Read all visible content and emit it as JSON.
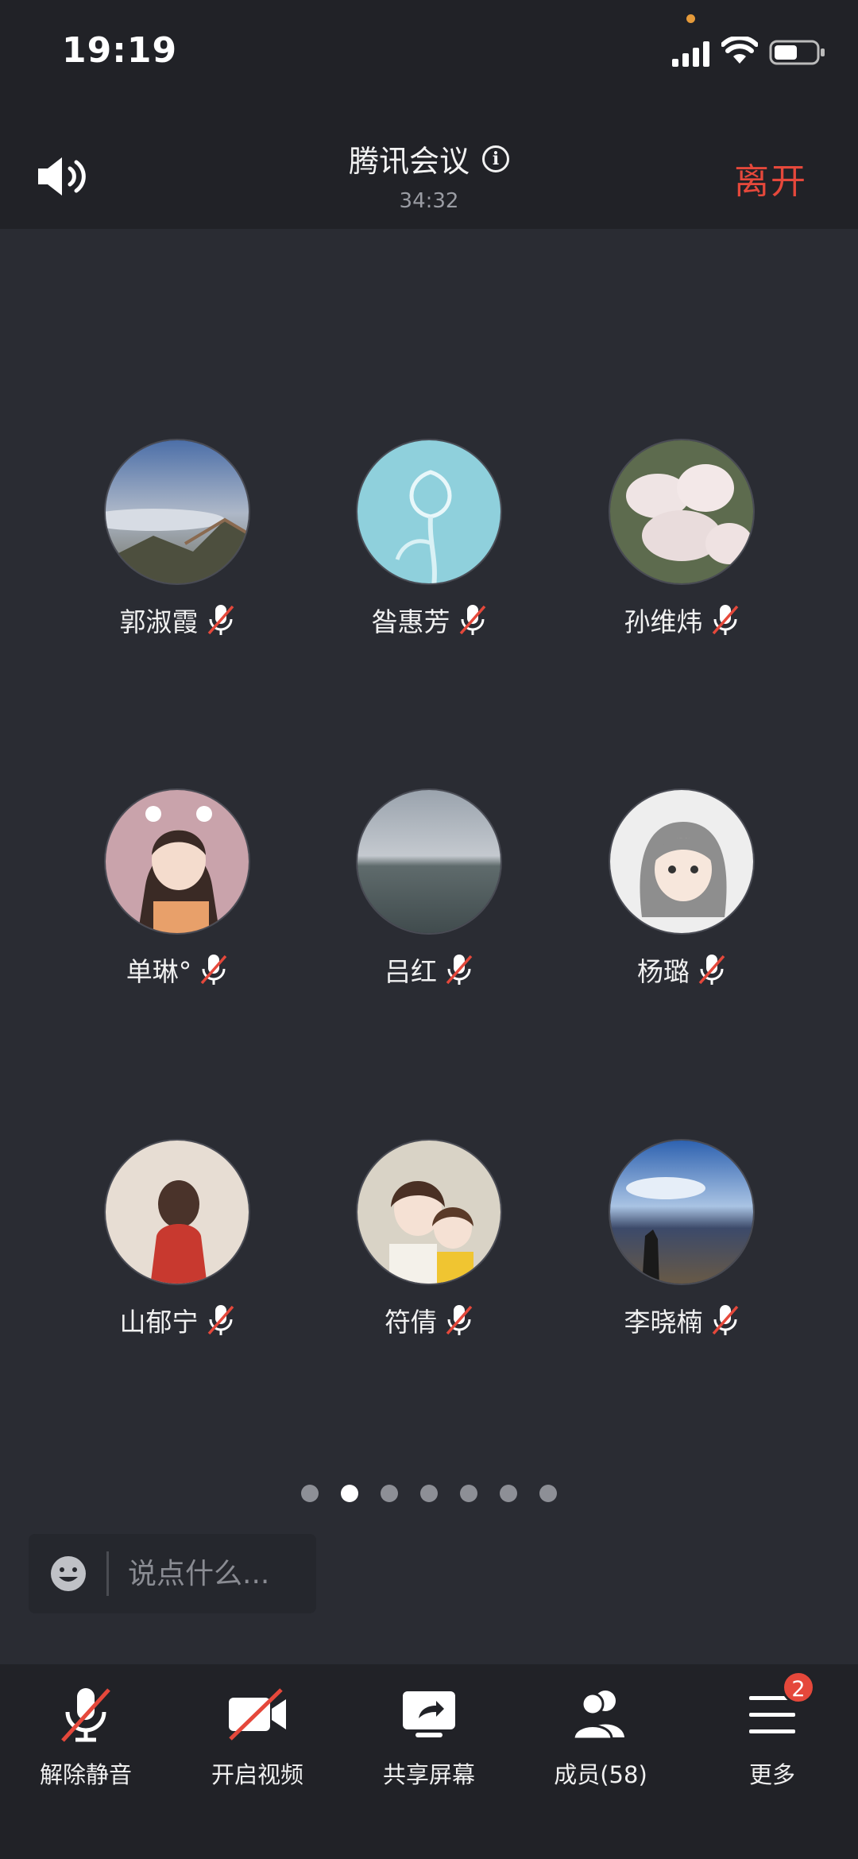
{
  "status_bar": {
    "time": "19:19"
  },
  "header": {
    "title": "腾讯会议",
    "timer": "34:32",
    "leave_label": "离开"
  },
  "participants": [
    {
      "name": "郭淑霞"
    },
    {
      "name": "昝惠芳"
    },
    {
      "name": "孙维炜"
    },
    {
      "name": "单琳°"
    },
    {
      "name": "吕红"
    },
    {
      "name": "杨璐"
    },
    {
      "name": "山郁宁"
    },
    {
      "name": "符倩"
    },
    {
      "name": "李晓楠"
    }
  ],
  "pager": {
    "pages": 7,
    "current": 2
  },
  "chat": {
    "placeholder": "说点什么..."
  },
  "toolbar": {
    "unmute_label": "解除静音",
    "video_label": "开启视频",
    "share_label": "共享屏幕",
    "members_label": "成员(58)",
    "more_label": "更多",
    "more_badge": "2"
  },
  "colors": {
    "accent_red": "#e5483b",
    "background": "#2a2c33",
    "bar": "#212227"
  }
}
